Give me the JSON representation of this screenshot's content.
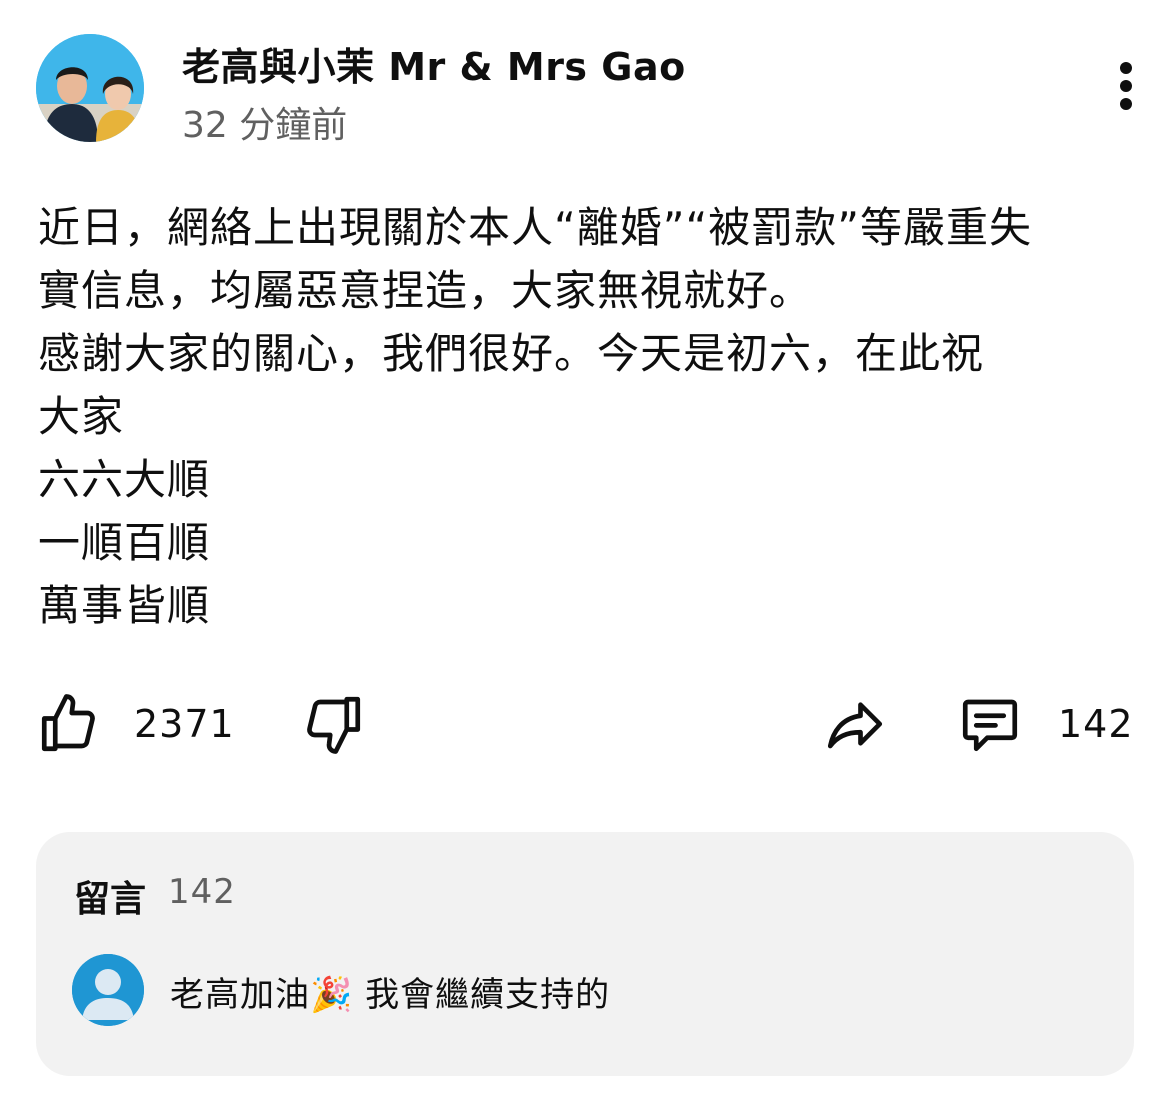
{
  "channel": {
    "name": "老高與小茉 Mr & Mrs Gao",
    "time": "32 分鐘前"
  },
  "post": {
    "lines": [
      "近日，網絡上出現關於本人“離婚”“被罰款”等嚴重失",
      "實信息，均屬惡意捏造，大家無視就好。",
      "感謝大家的關心，我們很好。今天是初六，在此祝",
      "大家",
      "六六大順",
      "一順百順",
      "萬事皆順"
    ]
  },
  "actions": {
    "like_count": "2371",
    "comment_count": "142",
    "like_icon": "thumbs-up-icon",
    "dislike_icon": "thumbs-down-icon",
    "share_icon": "share-icon",
    "comment_icon": "comment-icon"
  },
  "comments": {
    "title": "留言",
    "count": "142",
    "preview": {
      "text": "老高加油🎉 我會繼續支持的",
      "avatar_color": "#1f96d3"
    }
  },
  "colors": {
    "text": "#0f0f0f",
    "secondary": "#606060",
    "panel": "#f2f2f2",
    "avatar_bg": "#3fb6ea"
  }
}
